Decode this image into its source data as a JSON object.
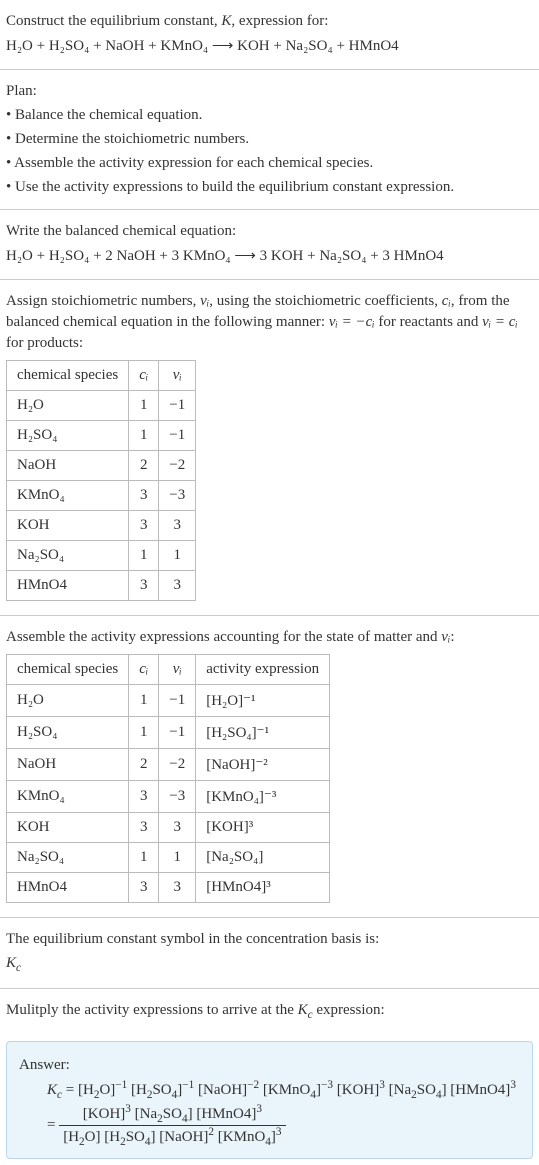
{
  "intro": {
    "prompt_line1": "Construct the equilibrium constant, ",
    "K": "K",
    "prompt_line1b": ", expression for:",
    "equation_text": "H₂O + H₂SO₄ + NaOH + KMnO₄  ⟶  KOH + Na₂SO₄ + HMnO4"
  },
  "plan": {
    "heading": "Plan:",
    "b1": "• Balance the chemical equation.",
    "b2": "• Determine the stoichiometric numbers.",
    "b3": "• Assemble the activity expression for each chemical species.",
    "b4": "• Use the activity expressions to build the equilibrium constant expression."
  },
  "balanced": {
    "heading": "Write the balanced chemical equation:",
    "equation_text": "H₂O + H₂SO₄ + 2 NaOH + 3 KMnO₄  ⟶  3 KOH + Na₂SO₄ + 3 HMnO4"
  },
  "stoich": {
    "intro1": "Assign stoichiometric numbers, ",
    "nu_i": "νᵢ",
    "intro2": ", using the stoichiometric coefficients, ",
    "c_i": "cᵢ",
    "intro3": ", from the balanced chemical equation in the following manner: ",
    "rel1": "νᵢ = −cᵢ",
    "intro4": " for reactants and ",
    "rel2": "νᵢ = cᵢ",
    "intro5": " for products:",
    "headers": {
      "species": "chemical species",
      "ci": "cᵢ",
      "nui": "νᵢ"
    },
    "rows": [
      {
        "species": "H₂O",
        "ci": "1",
        "nui": "−1"
      },
      {
        "species": "H₂SO₄",
        "ci": "1",
        "nui": "−1"
      },
      {
        "species": "NaOH",
        "ci": "2",
        "nui": "−2"
      },
      {
        "species": "KMnO₄",
        "ci": "3",
        "nui": "−3"
      },
      {
        "species": "KOH",
        "ci": "3",
        "nui": "3"
      },
      {
        "species": "Na₂SO₄",
        "ci": "1",
        "nui": "1"
      },
      {
        "species": "HMnO4",
        "ci": "3",
        "nui": "3"
      }
    ]
  },
  "activity": {
    "heading1": "Assemble the activity expressions accounting for the state of matter and ",
    "nu_i": "νᵢ",
    "heading2": ":",
    "headers": {
      "species": "chemical species",
      "ci": "cᵢ",
      "nui": "νᵢ",
      "act": "activity expression"
    },
    "rows": [
      {
        "species": "H₂O",
        "ci": "1",
        "nui": "−1",
        "act": "[H₂O]⁻¹"
      },
      {
        "species": "H₂SO₄",
        "ci": "1",
        "nui": "−1",
        "act": "[H₂SO₄]⁻¹"
      },
      {
        "species": "NaOH",
        "ci": "2",
        "nui": "−2",
        "act": "[NaOH]⁻²"
      },
      {
        "species": "KMnO₄",
        "ci": "3",
        "nui": "−3",
        "act": "[KMnO₄]⁻³"
      },
      {
        "species": "KOH",
        "ci": "3",
        "nui": "3",
        "act": "[KOH]³"
      },
      {
        "species": "Na₂SO₄",
        "ci": "1",
        "nui": "1",
        "act": "[Na₂SO₄]"
      },
      {
        "species": "HMnO4",
        "ci": "3",
        "nui": "3",
        "act": "[HMnO4]³"
      }
    ]
  },
  "basis": {
    "line1": "The equilibrium constant symbol in the concentration basis is:",
    "symbol": "K_c"
  },
  "multiply": {
    "line1a": "Mulitply the activity expressions to arrive at the ",
    "Kc": "K_c",
    "line1b": " expression:"
  },
  "answer": {
    "label": "Answer:",
    "line1": "K_c = [H₂O]⁻¹ [H₂SO₄]⁻¹ [NaOH]⁻² [KMnO₄]⁻³ [KOH]³ [Na₂SO₄] [HMnO4]³",
    "frac_num": "[KOH]³ [Na₂SO₄] [HMnO4]³",
    "frac_den": "[H₂O] [H₂SO₄] [NaOH]² [KMnO₄]³",
    "equals": "= "
  }
}
